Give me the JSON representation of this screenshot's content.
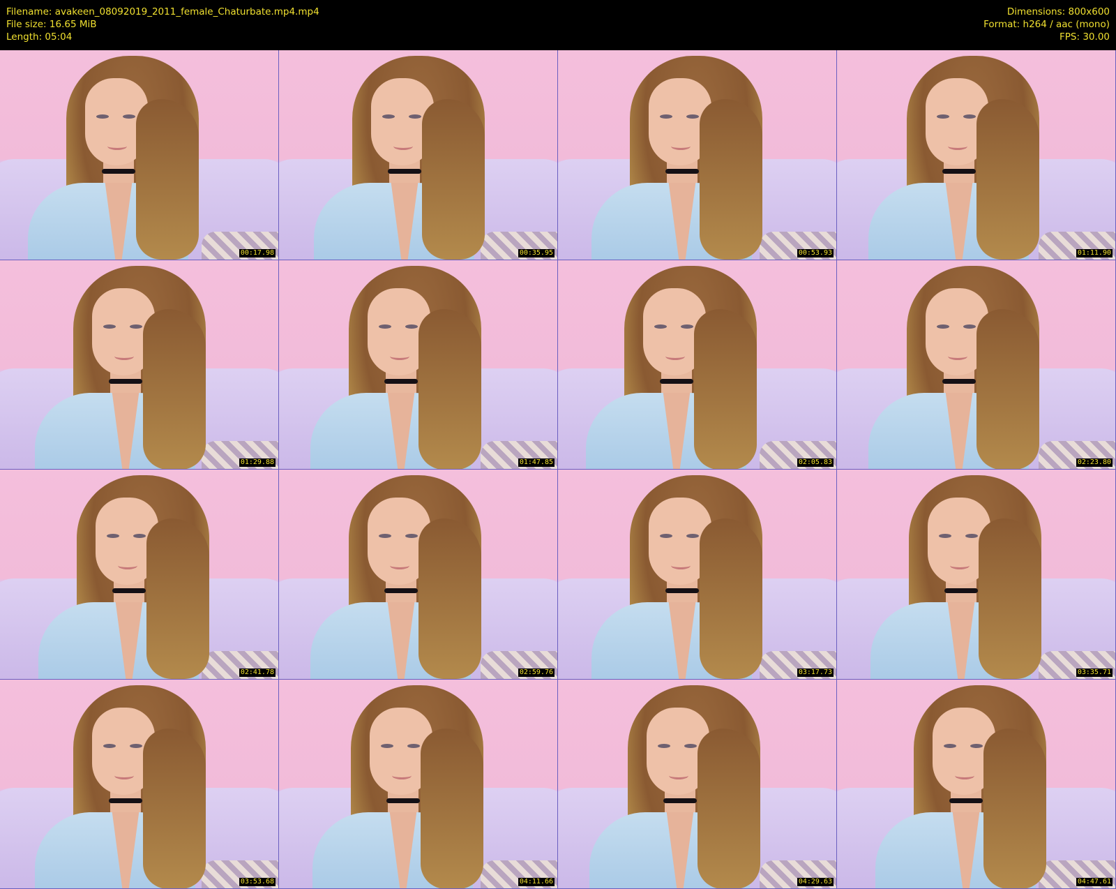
{
  "header": {
    "filename": "Filename: avakeen_08092019_2011_female_Chaturbate.mp4.mp4",
    "filesize": "File size: 16.65 MiB",
    "length": "Length: 05:04",
    "dimensions": "Dimensions: 800x600",
    "format": "Format: h264 / aac (mono)",
    "fps": "FPS: 30.00"
  },
  "thumbnails": [
    {
      "timestamp": "00:17.98"
    },
    {
      "timestamp": "00:35.95"
    },
    {
      "timestamp": "00:53.93"
    },
    {
      "timestamp": "01:11.90"
    },
    {
      "timestamp": "01:29.88"
    },
    {
      "timestamp": "01:47.85"
    },
    {
      "timestamp": "02:05.83"
    },
    {
      "timestamp": "02:23.80"
    },
    {
      "timestamp": "02:41.78"
    },
    {
      "timestamp": "02:59.76"
    },
    {
      "timestamp": "03:17.73"
    },
    {
      "timestamp": "03:35.71"
    },
    {
      "timestamp": "03:53.68"
    },
    {
      "timestamp": "04:11.66"
    },
    {
      "timestamp": "04:29.63"
    },
    {
      "timestamp": "04:47.61"
    }
  ],
  "colors": {
    "header_text": "#f0e030",
    "background": "#000000",
    "wall": "#f2bbd9",
    "sofa": "#cbb4e8"
  }
}
